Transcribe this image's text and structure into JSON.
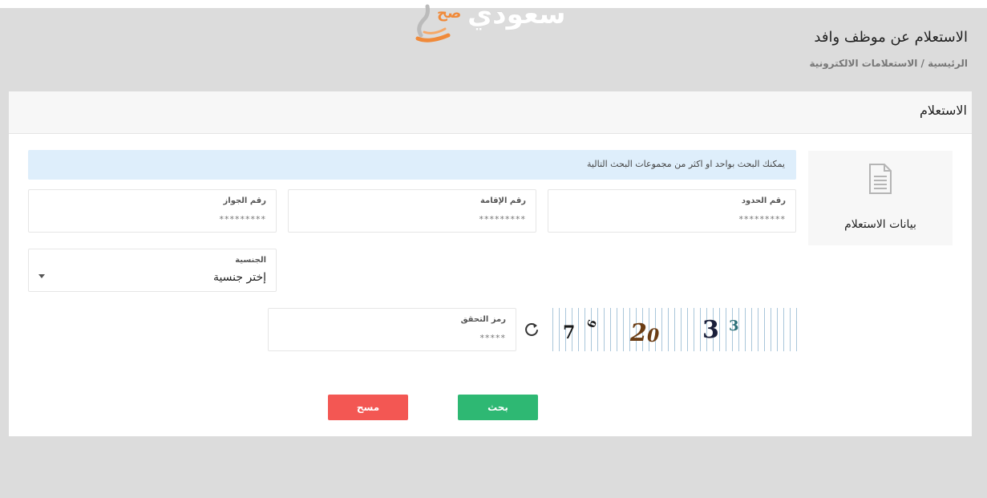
{
  "header": {
    "logo_text": "سعودي",
    "logo_sub": "صح",
    "page_title": "الاستعلام عن موظف وافد",
    "breadcrumb": "الرئيسية / الاستعلامات الالكترونية"
  },
  "panel": {
    "title": "الاستعلام"
  },
  "side_card": {
    "icon": "document-icon",
    "label": "بيانات الاستعلام"
  },
  "alert": {
    "text": "يمكنك البحث بواحد او اكثر من مجموعات البحث التالية"
  },
  "fields": {
    "border_number": {
      "label": "رقم الحدود",
      "placeholder": "*********",
      "value": ""
    },
    "iqama_number": {
      "label": "رقم الإقامة",
      "placeholder": "*********",
      "value": ""
    },
    "passport_number": {
      "label": "رقم الجواز",
      "placeholder": "*********",
      "value": ""
    },
    "nationality": {
      "label": "الجنسية",
      "selected": "إختر جنسية"
    },
    "captcha_code": {
      "label": "رمز التحقق",
      "placeholder": "*****",
      "value": ""
    }
  },
  "captcha": {
    "digits": [
      "7",
      "6",
      "2",
      "0",
      "3",
      "3"
    ],
    "refresh_icon": "refresh-icon"
  },
  "buttons": {
    "search": "بحث",
    "clear": "مسح"
  },
  "colors": {
    "search_button": "#2eb873",
    "clear_button": "#f35753",
    "alert_background": "#deeefb",
    "page_background": "#dcdcdc",
    "logo_accent": "#f08a3a"
  }
}
